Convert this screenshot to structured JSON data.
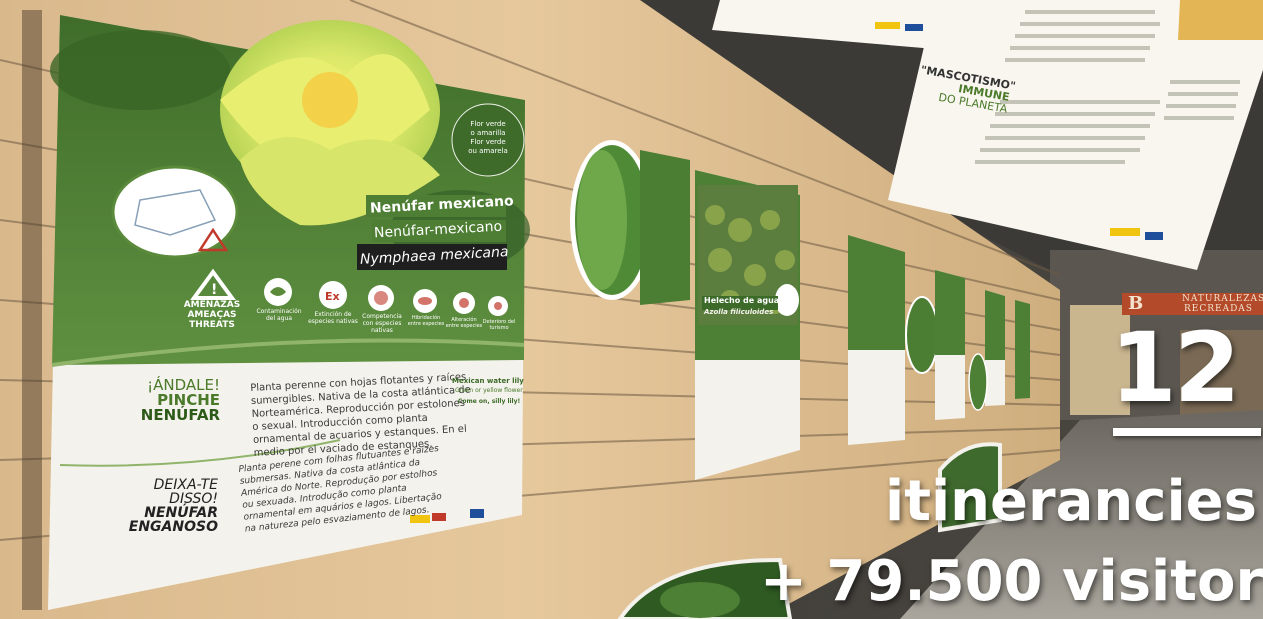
{
  "overlay": {
    "count": "12",
    "count_label": "itinerancies",
    "visitors": "+ 79.500 visitors"
  },
  "main_poster": {
    "name_es": "Nenúfar mexicano",
    "name_ca": "Nenúfar-mexicano",
    "name_sci": "Nymphaea mexicana",
    "flower_note": [
      "Flor verde",
      "o amarilla",
      "Flor verde",
      "ou amarela"
    ],
    "threats": [
      "AMENAZAS",
      "AMEAÇAS",
      "THREATS"
    ],
    "threat_items": [
      {
        "label": "Contaminación del agua",
        "icon": "leaf"
      },
      {
        "label": "Extinción de especies nativas",
        "icon": "Ex"
      },
      {
        "label": "Competencia con especies nativas",
        "icon": "shell"
      },
      {
        "label": "Hibridación entre especies",
        "icon": "fish"
      },
      {
        "label": "Alteración entre especies",
        "icon": "bug"
      },
      {
        "label": "Deterioro del turismo",
        "icon": "flower"
      }
    ],
    "slogan_es": [
      "¡ÁNDALE!",
      "PINCHE",
      "NENÚFAR"
    ],
    "slogan_pt": [
      "DEIXA-TE",
      "DISSO!",
      "NENÚFAR",
      "ENGANOSO"
    ],
    "text_es": [
      "Planta perenne con hojas flotantes y raíces",
      "sumergibles. Nativa de la costa atlántica de",
      "Norteamérica. Reproducción por estolones",
      "o sexual. Introducción como planta",
      "ornamental de acuarios y estanques. En el",
      "medio por el  vaciado de estanques."
    ],
    "text_pt": [
      "Planta perene com folhas flutuantes e raízes",
      "submersas. Nativa da costa atlântica da",
      "América do Norte. Reprodução por estolhos",
      "ou sexuada. Introdução como planta",
      "ornamental em aquários e lagos. Libertação",
      "na natureza pelo esvaziamento de lagos."
    ],
    "text_en_title": "Mexican water lily",
    "text_en_sub": "Green or yellow flower",
    "text_en_head": "Come on, silly lily!"
  },
  "second_poster": {
    "title": "Helecho de agua",
    "sci": "Azolla filiculoides"
  },
  "top_poster": {
    "slogan": [
      "\"MASCOTISMO\"",
      "IMMUNE",
      "DO PLANETA"
    ]
  },
  "sign": {
    "letter": "B",
    "line1": "NATURALEZAS",
    "line2": "RECREADAS"
  },
  "colors": {
    "poster_green": "#5a8a3a",
    "poster_dark_green": "#3c6a28",
    "wood": "#e2c59a",
    "overlay_text": "#ffffff"
  }
}
